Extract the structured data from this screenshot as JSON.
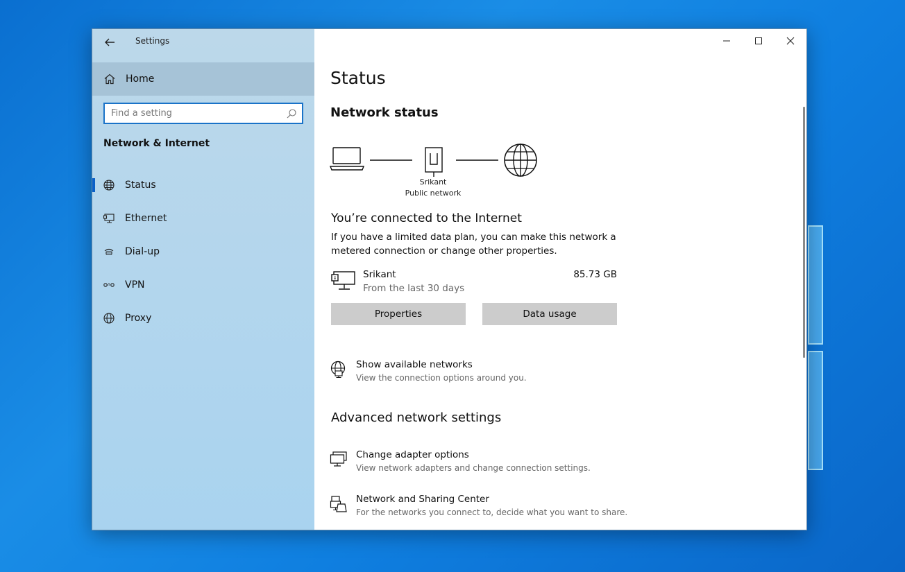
{
  "window": {
    "app_title": "Settings",
    "controls": {
      "minimize": "minimize-icon",
      "maximize": "maximize-icon",
      "close": "close-icon"
    }
  },
  "sidebar": {
    "home_label": "Home",
    "search_placeholder": "Find a setting",
    "section_heading": "Network & Internet",
    "items": [
      {
        "label": "Status",
        "icon": "status-globe-icon",
        "active": true
      },
      {
        "label": "Ethernet",
        "icon": "ethernet-icon",
        "active": false
      },
      {
        "label": "Dial-up",
        "icon": "dial-up-icon",
        "active": false
      },
      {
        "label": "VPN",
        "icon": "vpn-icon",
        "active": false
      },
      {
        "label": "Proxy",
        "icon": "proxy-globe-icon",
        "active": false
      }
    ]
  },
  "main": {
    "page_title": "Status",
    "network_status_heading": "Network status",
    "diagram": {
      "network_name": "Srikant",
      "network_type": "Public network"
    },
    "connected_heading": "You’re connected to the Internet",
    "connected_description": "If you have a limited data plan, you can make this network a metered connection or change other properties.",
    "connection": {
      "name": "Srikant",
      "subtitle": "From the last 30 days",
      "usage": "85.73 GB"
    },
    "buttons": {
      "properties": "Properties",
      "data_usage": "Data usage"
    },
    "show_networks": {
      "title": "Show available networks",
      "subtitle": "View the connection options around you."
    },
    "advanced_heading": "Advanced network settings",
    "advanced_links": [
      {
        "title": "Change adapter options",
        "subtitle": "View network adapters and change connection settings."
      },
      {
        "title": "Network and Sharing Center",
        "subtitle": "For the networks you connect to, decide what you want to share."
      }
    ]
  },
  "colors": {
    "accent": "#0a60c8",
    "sidebar_bg": "#b3d6ed",
    "button_bg": "#cccccc",
    "desktop_bg": "#1a8de6"
  }
}
